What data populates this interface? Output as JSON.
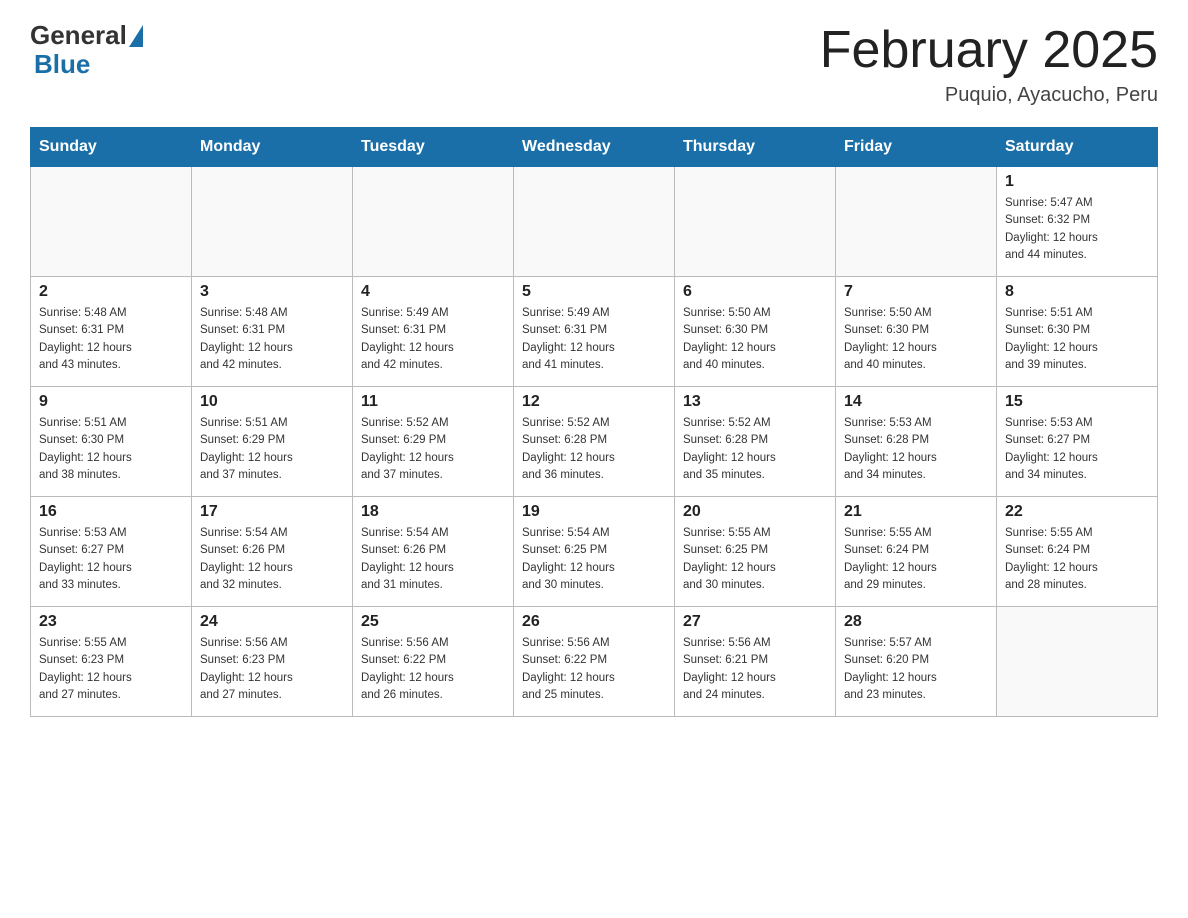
{
  "header": {
    "logo_general": "General",
    "logo_blue": "Blue",
    "title": "February 2025",
    "location": "Puquio, Ayacucho, Peru"
  },
  "days_of_week": [
    "Sunday",
    "Monday",
    "Tuesday",
    "Wednesday",
    "Thursday",
    "Friday",
    "Saturday"
  ],
  "weeks": [
    [
      {
        "day": "",
        "info": ""
      },
      {
        "day": "",
        "info": ""
      },
      {
        "day": "",
        "info": ""
      },
      {
        "day": "",
        "info": ""
      },
      {
        "day": "",
        "info": ""
      },
      {
        "day": "",
        "info": ""
      },
      {
        "day": "1",
        "info": "Sunrise: 5:47 AM\nSunset: 6:32 PM\nDaylight: 12 hours\nand 44 minutes."
      }
    ],
    [
      {
        "day": "2",
        "info": "Sunrise: 5:48 AM\nSunset: 6:31 PM\nDaylight: 12 hours\nand 43 minutes."
      },
      {
        "day": "3",
        "info": "Sunrise: 5:48 AM\nSunset: 6:31 PM\nDaylight: 12 hours\nand 42 minutes."
      },
      {
        "day": "4",
        "info": "Sunrise: 5:49 AM\nSunset: 6:31 PM\nDaylight: 12 hours\nand 42 minutes."
      },
      {
        "day": "5",
        "info": "Sunrise: 5:49 AM\nSunset: 6:31 PM\nDaylight: 12 hours\nand 41 minutes."
      },
      {
        "day": "6",
        "info": "Sunrise: 5:50 AM\nSunset: 6:30 PM\nDaylight: 12 hours\nand 40 minutes."
      },
      {
        "day": "7",
        "info": "Sunrise: 5:50 AM\nSunset: 6:30 PM\nDaylight: 12 hours\nand 40 minutes."
      },
      {
        "day": "8",
        "info": "Sunrise: 5:51 AM\nSunset: 6:30 PM\nDaylight: 12 hours\nand 39 minutes."
      }
    ],
    [
      {
        "day": "9",
        "info": "Sunrise: 5:51 AM\nSunset: 6:30 PM\nDaylight: 12 hours\nand 38 minutes."
      },
      {
        "day": "10",
        "info": "Sunrise: 5:51 AM\nSunset: 6:29 PM\nDaylight: 12 hours\nand 37 minutes."
      },
      {
        "day": "11",
        "info": "Sunrise: 5:52 AM\nSunset: 6:29 PM\nDaylight: 12 hours\nand 37 minutes."
      },
      {
        "day": "12",
        "info": "Sunrise: 5:52 AM\nSunset: 6:28 PM\nDaylight: 12 hours\nand 36 minutes."
      },
      {
        "day": "13",
        "info": "Sunrise: 5:52 AM\nSunset: 6:28 PM\nDaylight: 12 hours\nand 35 minutes."
      },
      {
        "day": "14",
        "info": "Sunrise: 5:53 AM\nSunset: 6:28 PM\nDaylight: 12 hours\nand 34 minutes."
      },
      {
        "day": "15",
        "info": "Sunrise: 5:53 AM\nSunset: 6:27 PM\nDaylight: 12 hours\nand 34 minutes."
      }
    ],
    [
      {
        "day": "16",
        "info": "Sunrise: 5:53 AM\nSunset: 6:27 PM\nDaylight: 12 hours\nand 33 minutes."
      },
      {
        "day": "17",
        "info": "Sunrise: 5:54 AM\nSunset: 6:26 PM\nDaylight: 12 hours\nand 32 minutes."
      },
      {
        "day": "18",
        "info": "Sunrise: 5:54 AM\nSunset: 6:26 PM\nDaylight: 12 hours\nand 31 minutes."
      },
      {
        "day": "19",
        "info": "Sunrise: 5:54 AM\nSunset: 6:25 PM\nDaylight: 12 hours\nand 30 minutes."
      },
      {
        "day": "20",
        "info": "Sunrise: 5:55 AM\nSunset: 6:25 PM\nDaylight: 12 hours\nand 30 minutes."
      },
      {
        "day": "21",
        "info": "Sunrise: 5:55 AM\nSunset: 6:24 PM\nDaylight: 12 hours\nand 29 minutes."
      },
      {
        "day": "22",
        "info": "Sunrise: 5:55 AM\nSunset: 6:24 PM\nDaylight: 12 hours\nand 28 minutes."
      }
    ],
    [
      {
        "day": "23",
        "info": "Sunrise: 5:55 AM\nSunset: 6:23 PM\nDaylight: 12 hours\nand 27 minutes."
      },
      {
        "day": "24",
        "info": "Sunrise: 5:56 AM\nSunset: 6:23 PM\nDaylight: 12 hours\nand 27 minutes."
      },
      {
        "day": "25",
        "info": "Sunrise: 5:56 AM\nSunset: 6:22 PM\nDaylight: 12 hours\nand 26 minutes."
      },
      {
        "day": "26",
        "info": "Sunrise: 5:56 AM\nSunset: 6:22 PM\nDaylight: 12 hours\nand 25 minutes."
      },
      {
        "day": "27",
        "info": "Sunrise: 5:56 AM\nSunset: 6:21 PM\nDaylight: 12 hours\nand 24 minutes."
      },
      {
        "day": "28",
        "info": "Sunrise: 5:57 AM\nSunset: 6:20 PM\nDaylight: 12 hours\nand 23 minutes."
      },
      {
        "day": "",
        "info": ""
      }
    ]
  ]
}
